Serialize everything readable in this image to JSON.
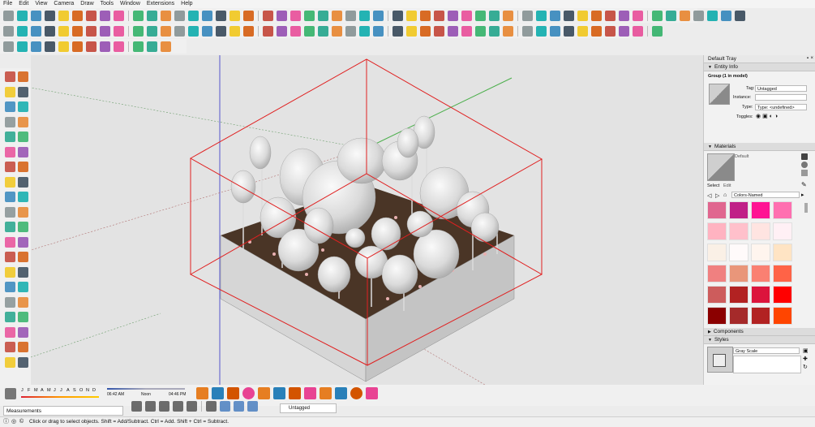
{
  "menu": [
    "File",
    "Edit",
    "View",
    "Camera",
    "Draw",
    "Tools",
    "Window",
    "Extensions",
    "Help"
  ],
  "tray": {
    "title": "Default Tray",
    "entity_info": {
      "header": "Entity Info",
      "selection": "Group (1 in model)",
      "tag_label": "Tag:",
      "tag_value": "Untagged",
      "instance_label": "Instance:",
      "type_label": "Type:",
      "type_value": "Type: <undefined>",
      "toggles_label": "Toggles:"
    },
    "materials": {
      "header": "Materials",
      "current": "Default",
      "tab_select": "Select",
      "tab_edit": "Edit",
      "library": "Colors-Named",
      "swatches": [
        "#e0668f",
        "#c01f87",
        "#ff1493",
        "#ff6fb0",
        "#ffb3c1",
        "#ffc0cb",
        "#ffe4e1",
        "#fff0f5",
        "#faf0e6",
        "#fffafa",
        "#fff5ee",
        "#ffe4c4",
        "#f08080",
        "#e9967a",
        "#fa8072",
        "#ff6347",
        "#cd5c5c",
        "#b22222",
        "#dc143c",
        "#ff0000",
        "#8b0000",
        "#a52a2a",
        "#b22222",
        "#ff4500"
      ]
    },
    "components": {
      "header": "Components"
    },
    "styles": {
      "header": "Styles",
      "name": "Gray Scale"
    }
  },
  "shadows": {
    "months": [
      "J",
      "F",
      "M",
      "A",
      "M",
      "J",
      "J",
      "A",
      "S",
      "O",
      "N",
      "D"
    ],
    "time_start": "06:42 AM",
    "time_noon": "Noon",
    "time_end": "04:46 PM"
  },
  "measurements_label": "Measurements",
  "tag_dropdown": "Untagged",
  "status_text": "Click or drag to select objects. Shift = Add/Subtract. Ctrl = Add. Shift + Ctrl = Subtract.",
  "colors": {
    "accent_red": "#e02020",
    "axis_green": "#3fa63f",
    "axis_blue": "#4040d0"
  }
}
